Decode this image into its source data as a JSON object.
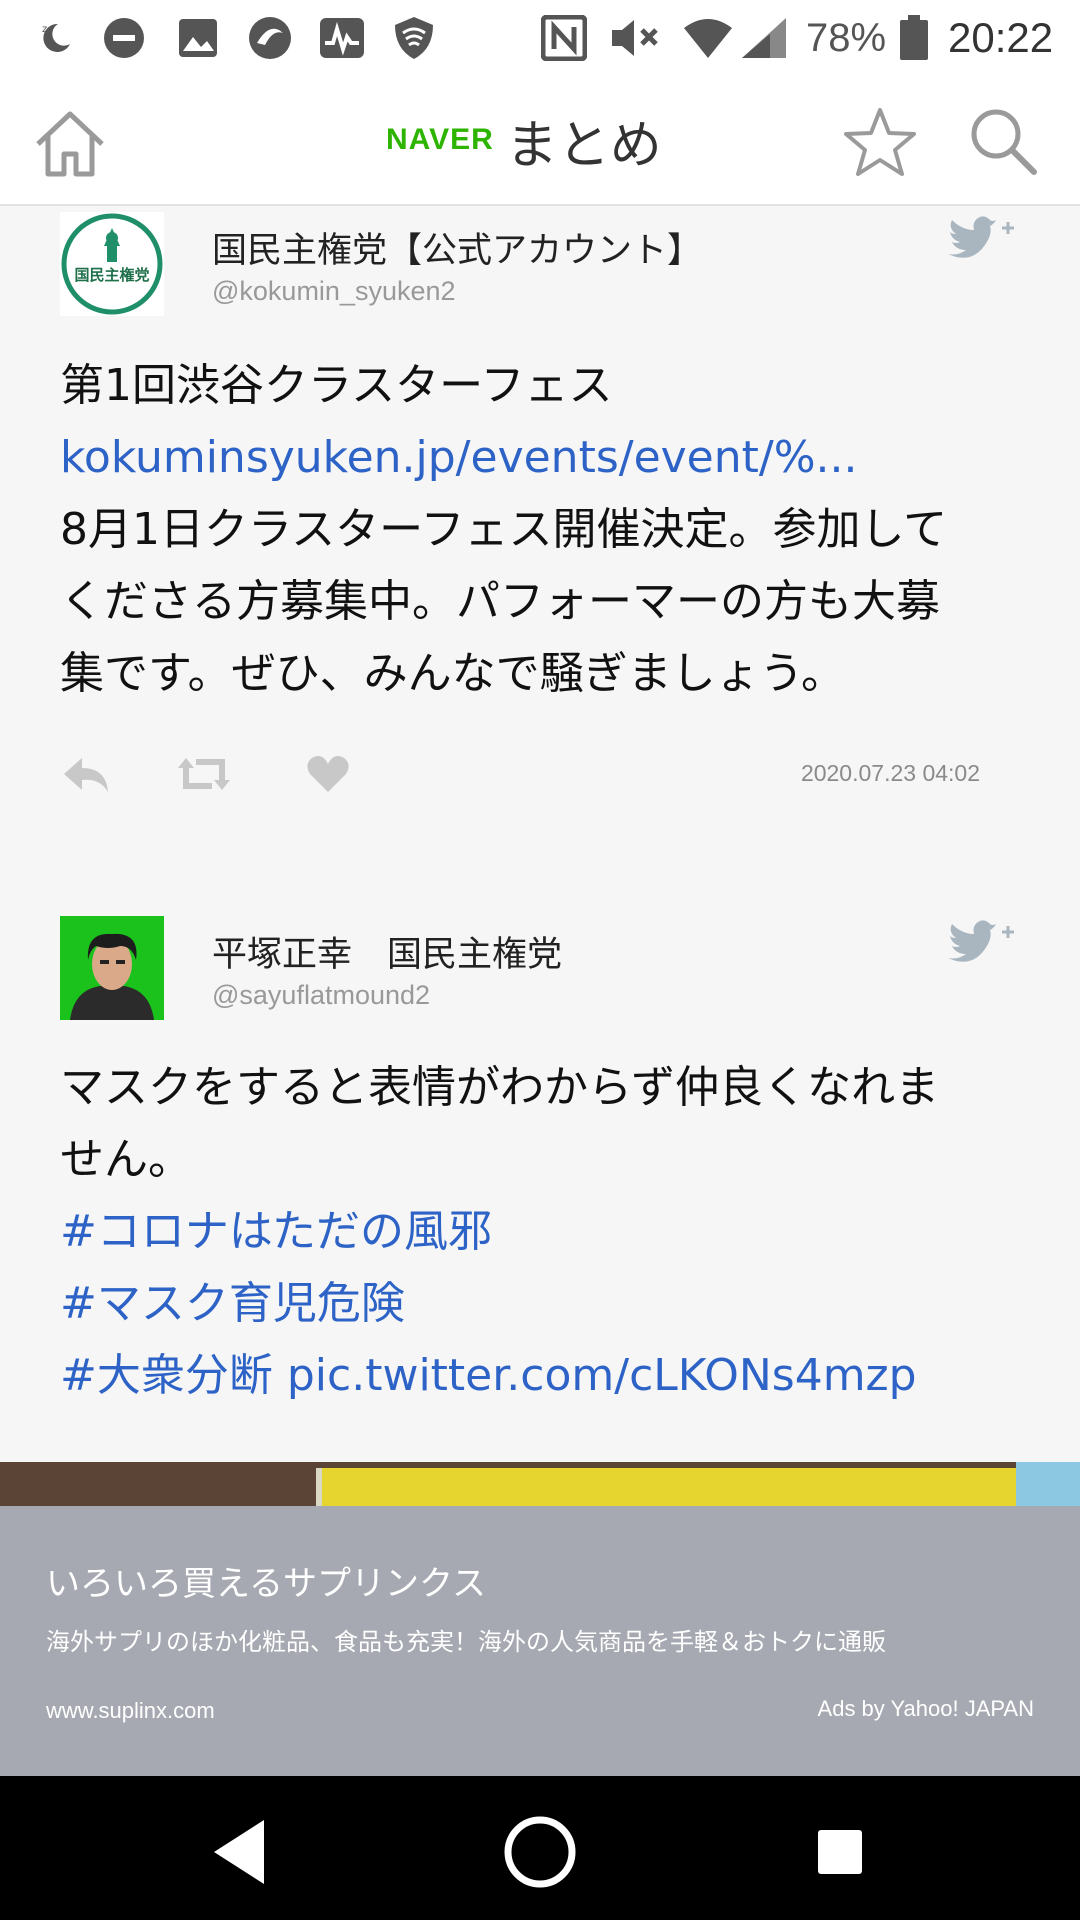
{
  "status_bar": {
    "battery_percent": "78%",
    "time": "20:22",
    "icons": [
      "moon-icon",
      "do-not-disturb-icon",
      "gallery-icon",
      "app-icon",
      "activity-icon",
      "shield-wifi-icon",
      "nfc-icon",
      "mute-icon",
      "wifi-icon",
      "signal-icon",
      "battery-icon"
    ]
  },
  "header": {
    "brand_naver": "NAVER",
    "brand_matome": "まとめ",
    "brand_color": "#2db400",
    "icons": [
      "home-icon",
      "star-icon",
      "search-icon"
    ]
  },
  "tweets": [
    {
      "name": "国民主権党【公式アカウント】",
      "handle": "@kokumin_syuken2",
      "avatar_text": "国民主権党",
      "lines": [
        "第1回渋谷クラスターフェス",
        "kokuminsyuken.jp/events/event/%...",
        "8月1日クラスターフェス開催決定。参加して",
        "くださる方募集中。パフォーマーの方も大募",
        "集です。ぜひ、みんなで騒ぎましょう。"
      ],
      "date": "2020.07.23 04:02"
    },
    {
      "name": "平塚正幸　国民主権党",
      "handle": "@sayuflatmound2",
      "lines": [
        "マスクをすると表情がわからず仲良くなれま",
        "せん。",
        "#コロナはただの風邪",
        "#マスク育児危険",
        "#大衆分断",
        "pic.twitter.com/cLKONs4mzp"
      ]
    }
  ],
  "link_color": "#2d62c6",
  "ad": {
    "title": "いろいろ買えるサプリンクス",
    "description": "海外サプリのほか化粧品、食品も充実！海外の人気商品を手軽＆おトクに通販",
    "url": "www.suplinx.com",
    "credit": "Ads by Yahoo! JAPAN"
  },
  "nav_bar": {
    "icons": [
      "back-icon",
      "home-circle-icon",
      "recents-icon"
    ]
  }
}
